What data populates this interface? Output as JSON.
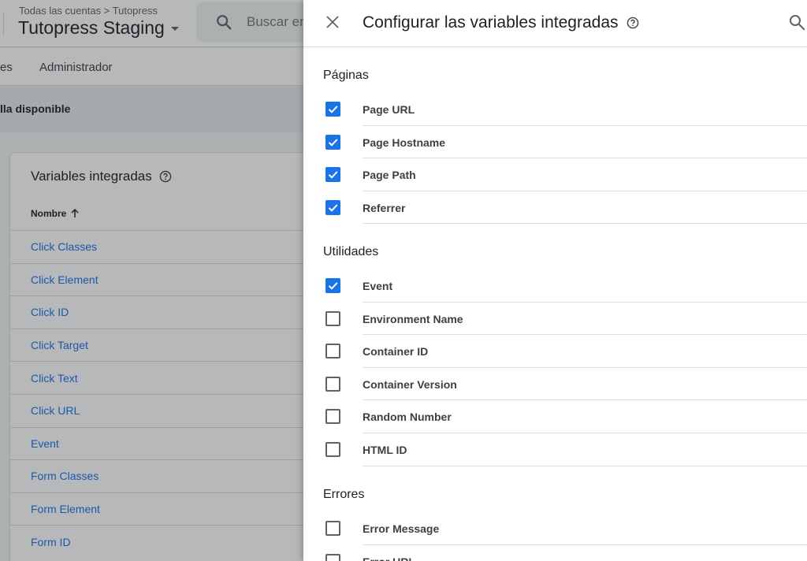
{
  "header": {
    "breadcrumb": "Todas las cuentas > Tutopress",
    "container_name": "Tutopress Staging",
    "search_placeholder": "Buscar en el espacio de trabajo"
  },
  "nav": {
    "items": [
      "es",
      "Administrador"
    ]
  },
  "banner": {
    "text": "lla disponible"
  },
  "card": {
    "title": "Variables integradas",
    "column_name": "Nombre",
    "rows": [
      "Click Classes",
      "Click Element",
      "Click ID",
      "Click Target",
      "Click Text",
      "Click URL",
      "Event",
      "Form Classes",
      "Form Element",
      "Form ID"
    ]
  },
  "panel": {
    "title": "Configurar las variables integradas",
    "sections": [
      {
        "title": "Páginas",
        "items": [
          {
            "label": "Page URL",
            "checked": true
          },
          {
            "label": "Page Hostname",
            "checked": true
          },
          {
            "label": "Page Path",
            "checked": true
          },
          {
            "label": "Referrer",
            "checked": true
          }
        ]
      },
      {
        "title": "Utilidades",
        "items": [
          {
            "label": "Event",
            "checked": true
          },
          {
            "label": "Environment Name",
            "checked": false
          },
          {
            "label": "Container ID",
            "checked": false
          },
          {
            "label": "Container Version",
            "checked": false
          },
          {
            "label": "Random Number",
            "checked": false
          },
          {
            "label": "HTML ID",
            "checked": false
          }
        ]
      },
      {
        "title": "Errores",
        "items": [
          {
            "label": "Error Message",
            "checked": false
          },
          {
            "label": "Error URL",
            "checked": false
          }
        ]
      }
    ]
  },
  "colors": {
    "accent": "#1a73e8",
    "link": "#1a73e8"
  }
}
